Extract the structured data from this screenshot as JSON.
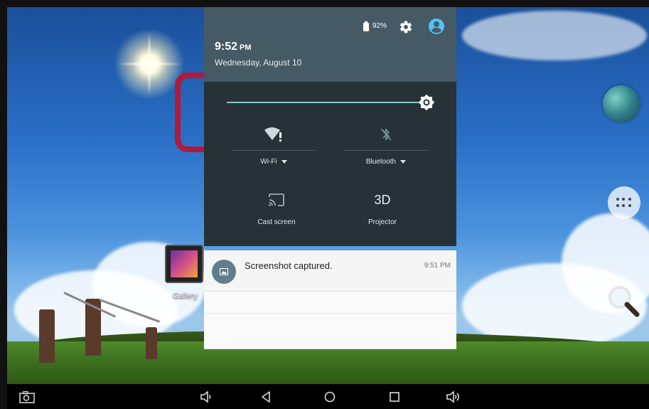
{
  "status": {
    "battery_percent": "92%",
    "time": "9:52",
    "ampm": "PM",
    "date": "Wednesday, August 10",
    "brightness_level": 0.97
  },
  "quick_settings": {
    "wifi_label": "Wi-Fi",
    "bluetooth_label": "Bluetooth",
    "cast_label": "Cast screen",
    "projector_icon_text": "3D",
    "projector_label": "Projector"
  },
  "notification": {
    "title": "Screenshot captured.",
    "time": "9:51 PM"
  },
  "home": {
    "gallery_label": "Gallery"
  },
  "colors": {
    "shade_header": "#455a64",
    "quick_settings_bg": "#263238",
    "accent": "#80cbc4",
    "account_icon": "#4fc3f7"
  }
}
